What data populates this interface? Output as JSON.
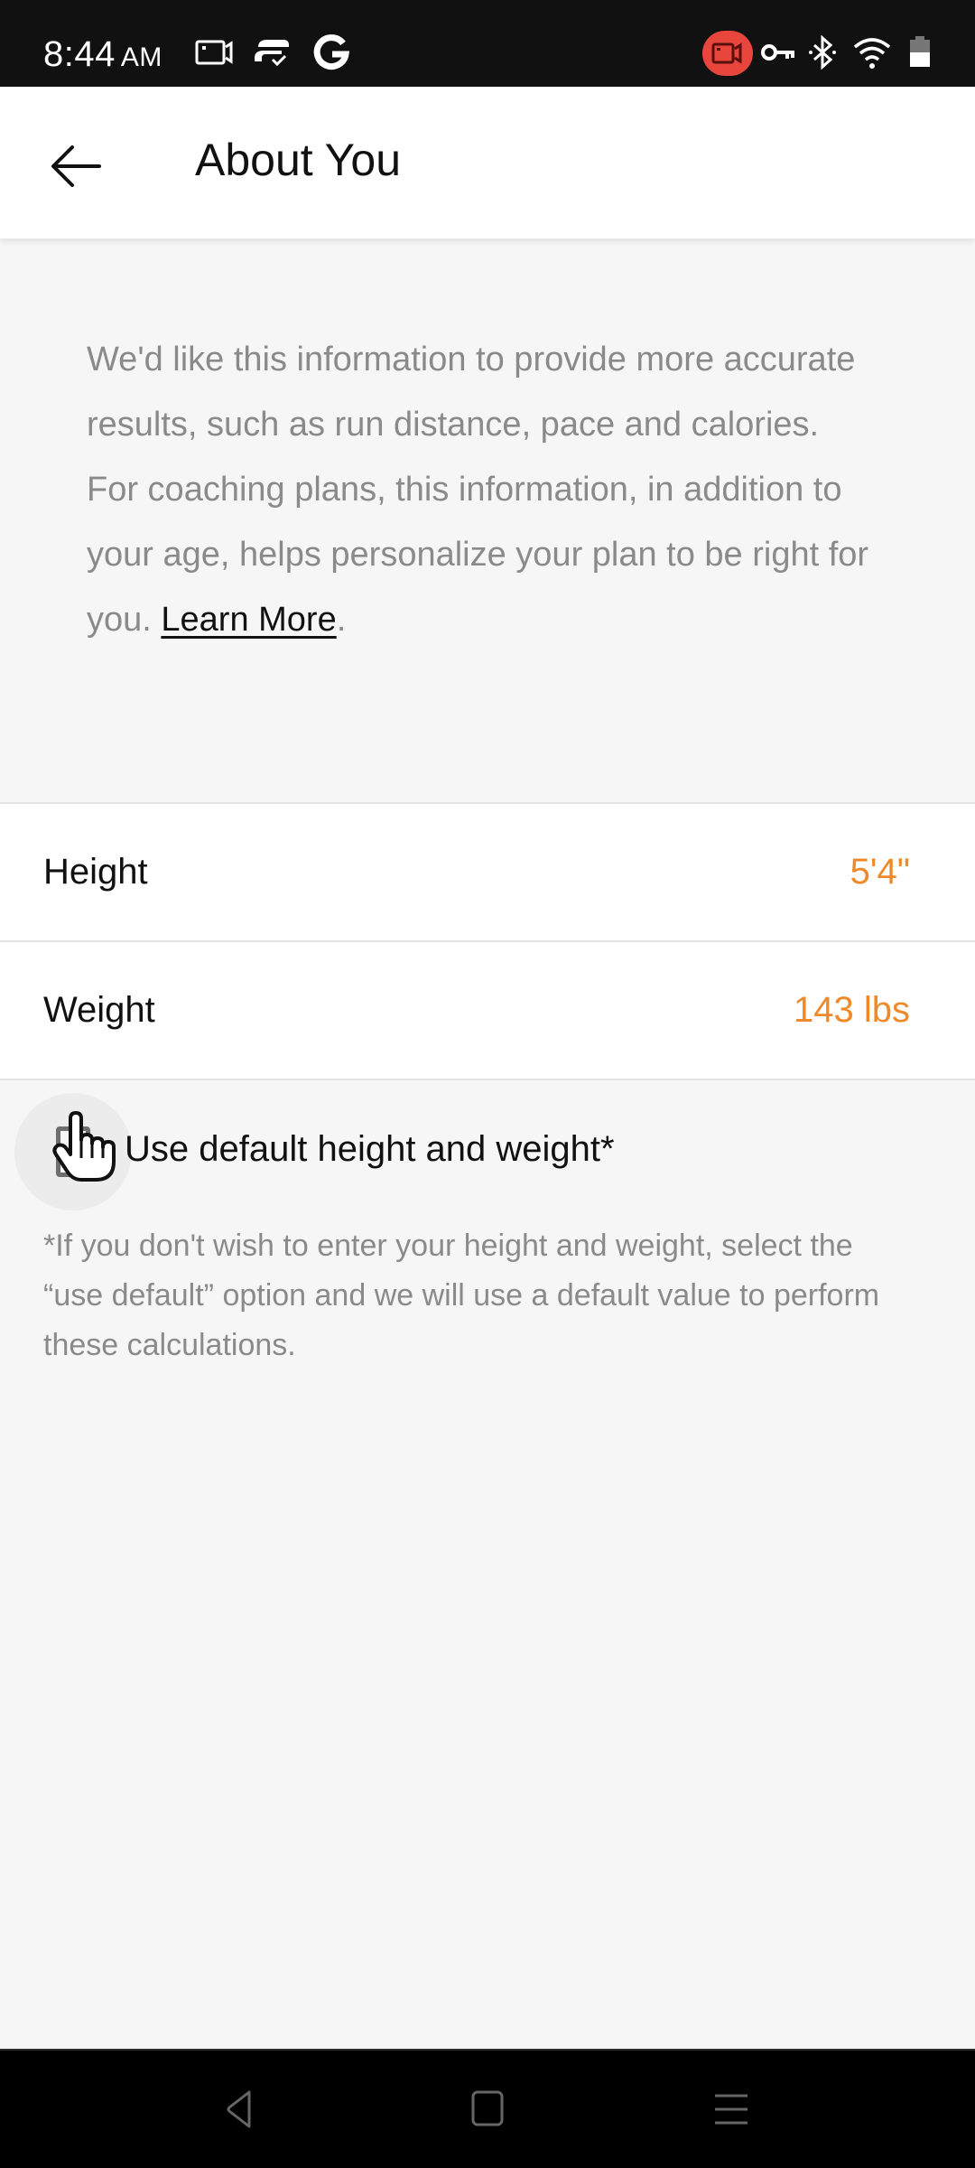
{
  "status_bar": {
    "time": "8:44",
    "ampm": "AM",
    "left_icons": [
      "screen-record-icon",
      "vpn-app-icon",
      "google-icon"
    ],
    "right_icons": [
      "recording-indicator-icon",
      "vpn-key-icon",
      "bluetooth-icon",
      "wifi-icon",
      "battery-icon"
    ],
    "recording_color": "#e8453c"
  },
  "header": {
    "back_icon": "arrow-left-icon",
    "title": "About You"
  },
  "intro": {
    "text": "We'd like this information to provide more accurate results, such as run distance, pace and calories. For coaching plans, this information, in addition to your age, helps personalize your plan to be right for you. ",
    "link": "Learn More",
    "link_suffix": "."
  },
  "settings": {
    "rows": [
      {
        "label": "Height",
        "value": "5'4\""
      },
      {
        "label": "Weight",
        "value": "143 lbs"
      }
    ],
    "value_color": "#ee8a2a"
  },
  "default_option": {
    "label": "Use default height and weight*",
    "checked": false
  },
  "footnote": "*If you don't wish to enter your height and weight, select the “use default” option and we will use a default value to perform these calculations.",
  "nav_bar": {
    "buttons": [
      "back-nav-icon",
      "home-nav-icon",
      "recents-nav-icon"
    ]
  }
}
